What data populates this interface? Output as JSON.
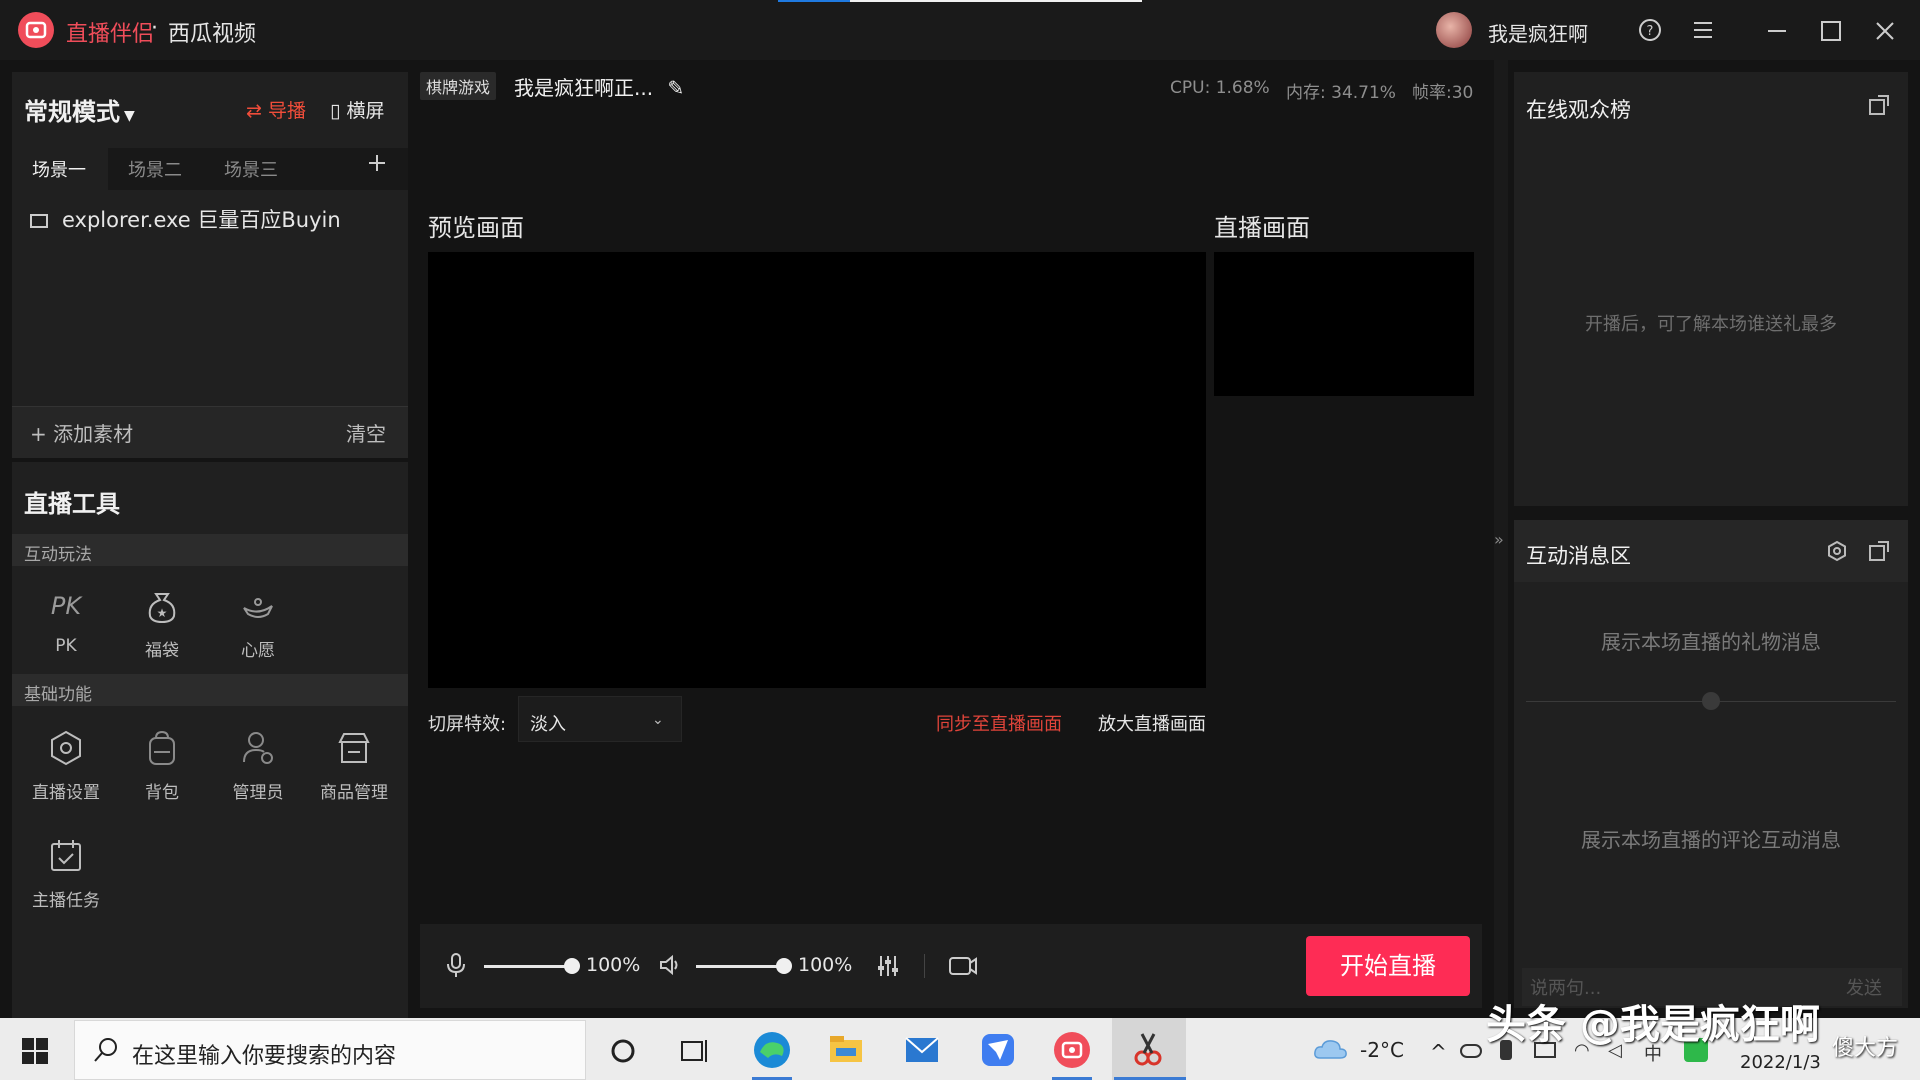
{
  "titlebar": {
    "app_name": "直播伴侣",
    "separator": "·",
    "platform": "西瓜视频",
    "username": "我是疯狂啊"
  },
  "left": {
    "mode": "常规模式",
    "director_label": "导播",
    "landscape_label": "横屏",
    "scene_tabs": [
      "场景一",
      "场景二",
      "场景三"
    ],
    "source_item": "explorer.exe 巨量百应Buyin",
    "add_material": "添加素材",
    "clear": "清空",
    "tools_title": "直播工具",
    "interactive_section": "互动玩法",
    "interactive_tools": [
      "PK",
      "福袋",
      "心愿"
    ],
    "basic_section": "基础功能",
    "basic_tools": [
      "直播设置",
      "背包",
      "管理员",
      "商品管理",
      "主播任务"
    ]
  },
  "center": {
    "category": "棋牌游戏",
    "stream_title": "我是疯狂啊正...",
    "cpu": "CPU: 1.68%",
    "memory": "内存: 34.71%",
    "fps": "帧率:30",
    "preview_label": "预览画面",
    "live_label": "直播画面",
    "transition_label": "切屏特效:",
    "transition_value": "淡入",
    "sync_link": "同步至直播画面",
    "zoom_link": "放大直播画面",
    "mic_volume": "100%",
    "speaker_volume": "100%",
    "start_button": "开始直播"
  },
  "right": {
    "audience_title": "在线观众榜",
    "audience_hint": "开播后，可了解本场谁送礼最多",
    "messages_title": "互动消息区",
    "gift_hint": "展示本场直播的礼物消息",
    "comment_hint": "展示本场直播的评论互动消息",
    "chat_placeholder": "说两句...",
    "send_label": "发送"
  },
  "taskbar": {
    "search_placeholder": "在这里输入你要搜索的内容",
    "temperature": "-2°C",
    "date": "2022/1/3"
  },
  "watermark": {
    "text": "头条 @我是疯狂啊",
    "corner": "傻大方"
  }
}
